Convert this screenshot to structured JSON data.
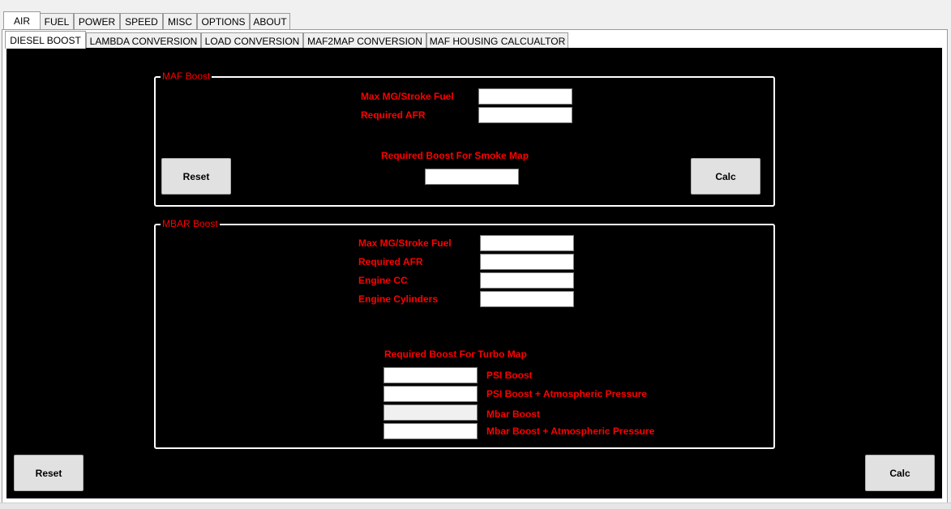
{
  "main_tabs": [
    {
      "label": "AIR",
      "active": true
    },
    {
      "label": "FUEL",
      "active": false
    },
    {
      "label": "POWER",
      "active": false
    },
    {
      "label": "SPEED",
      "active": false
    },
    {
      "label": "MISC",
      "active": false
    },
    {
      "label": "OPTIONS",
      "active": false
    },
    {
      "label": "ABOUT",
      "active": false
    }
  ],
  "sub_tabs": [
    {
      "label": "DIESEL BOOST",
      "active": true
    },
    {
      "label": "LAMBDA CONVERSION",
      "active": false
    },
    {
      "label": "LOAD CONVERSION",
      "active": false
    },
    {
      "label": "MAF2MAP CONVERSION",
      "active": false
    },
    {
      "label": "MAF HOUSING CALCUALTOR",
      "active": false
    }
  ],
  "maf_boost": {
    "title": "MAF Boost",
    "max_mg_label": "Max MG/Stroke Fuel",
    "max_mg_value": "",
    "afr_label": "Required AFR",
    "afr_value": "",
    "result_label": "Required Boost For Smoke Map",
    "result_value": "",
    "reset_label": "Reset",
    "calc_label": "Calc"
  },
  "mbar_boost": {
    "title": "MBAR Boost",
    "max_mg_label": "Max MG/Stroke Fuel",
    "max_mg_value": "",
    "afr_label": "Required AFR",
    "afr_value": "",
    "cc_label": "Engine CC",
    "cc_value": "",
    "cylinders_label": "Engine Cylinders",
    "cylinders_value": "",
    "result_label": "Required Boost For Turbo Map",
    "psi_label": "PSI Boost",
    "psi_value": "",
    "psi_atm_label": "PSI Boost + Atmospheric Pressure",
    "psi_atm_value": "",
    "mbar_label": "Mbar Boost",
    "mbar_value": "",
    "mbar_atm_label": "Mbar Boost + Atmospheric  Pressure",
    "mbar_atm_value": ""
  },
  "bottom": {
    "reset_label": "Reset",
    "calc_label": "Calc"
  }
}
